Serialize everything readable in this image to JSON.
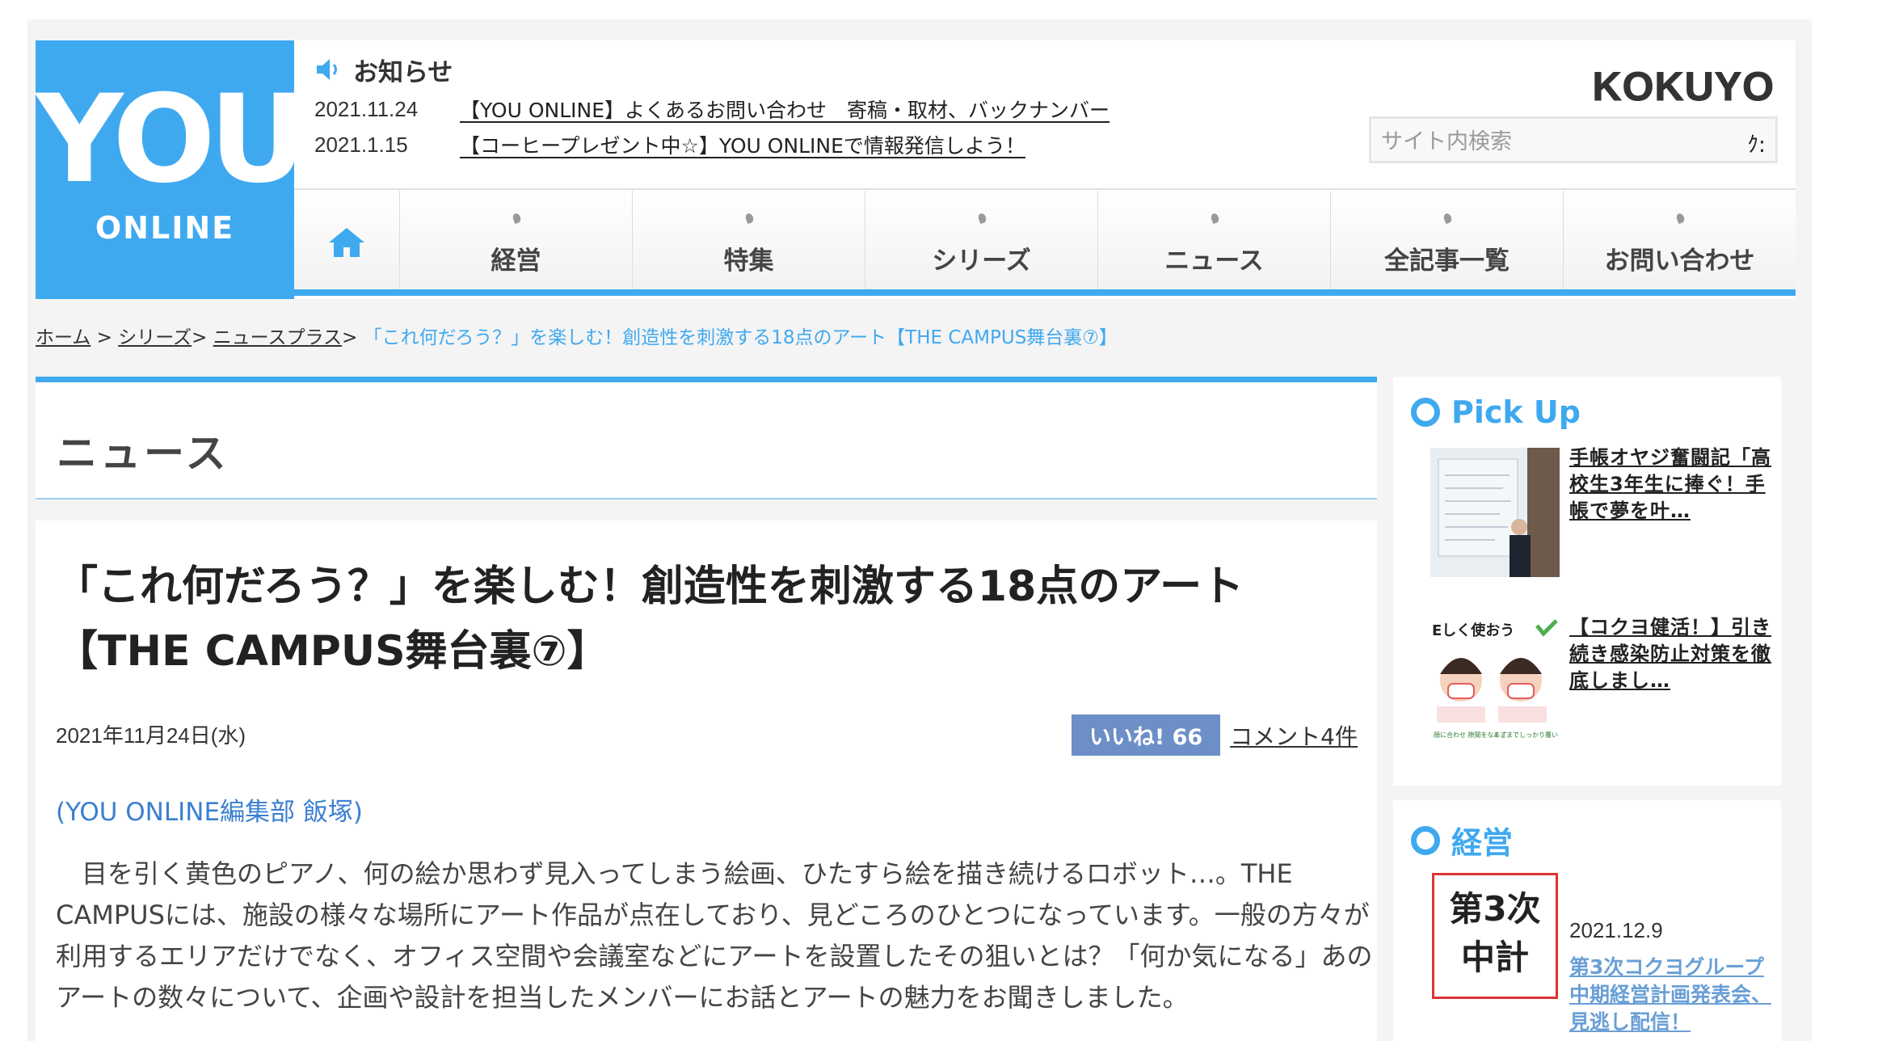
{
  "logo": {
    "main": "YOU",
    "sub": "ONLINE"
  },
  "notice": {
    "heading": "お知らせ",
    "items": [
      {
        "date": "2021.11.24",
        "text": "【YOU ONLINE】よくあるお問い合わせ　寄稿・取材、バックナンバー"
      },
      {
        "date": "2021.1.15",
        "text": "【コーヒープレゼント中☆】YOU ONLINEで情報発信しよう！"
      }
    ]
  },
  "brand": "KOKUYO",
  "search": {
    "placeholder": "サイト内検索",
    "button": "ｸ:"
  },
  "nav": {
    "items": [
      "経営",
      "特集",
      "シリーズ",
      "ニュース",
      "全記事一覧",
      "お問い合わせ"
    ]
  },
  "breadcrumb": {
    "home": "ホーム",
    "series": "シリーズ",
    "category": "ニュースプラス",
    "sep": " > ",
    "sep2": "> ",
    "current": "「これ何だろう？」を楽しむ！創造性を刺激する18点のアート【THE CAMPUS舞台裏⑦】"
  },
  "section": {
    "title": "ニュース"
  },
  "article": {
    "title": "「これ何だろう？」を楽しむ！創造性を刺激する18点のアート【THE CAMPUS舞台裏⑦】",
    "date": "2021年11月24日(水)",
    "like": "いいね! 66",
    "comments": "コメント4件",
    "author": "(YOU ONLINE編集部 飯塚)",
    "body": "目を引く黄色のピアノ、何の絵か思わず見入ってしまう絵画、ひたすら絵を描き続けるロボット…。THE CAMPUSには、施設の様々な場所にアート作品が点在しており、見どころのひとつになっています。一般の方々が利用するエリアだけでなく、オフィス空間や会議室などにアートを設置したその狙いとは？「何か気になる」あのアートの数々について、企画や設計を担当したメンバーにお話とアートの魅力をお聞きしました。"
  },
  "sidebar": {
    "pickup": {
      "title": "Pick Up",
      "items": [
        {
          "text": "手帳オヤジ奮闘記「高校生3年生に捧ぐ！手帳で夢を叶…"
        },
        {
          "text": "【コクヨ健活！】引き続き感染防止対策を徹底しまし…",
          "img_text": "Eしく使おう",
          "img_caption1": "顔に合わせ 隙間をなくす",
          "img_caption2": "あごまでしっかり覆い 鼻をフィット"
        }
      ]
    },
    "keiei": {
      "title": "経営",
      "item": {
        "badge_line1": "第3次",
        "badge_line2": "中計",
        "date": "2021.12.9",
        "text": "第3次コクヨグループ中期経営計画発表会、見逃し配信！"
      }
    }
  },
  "colors": {
    "accent": "#3fa9f0",
    "like": "#6d8fc7",
    "badge_border": "#dd3333"
  }
}
